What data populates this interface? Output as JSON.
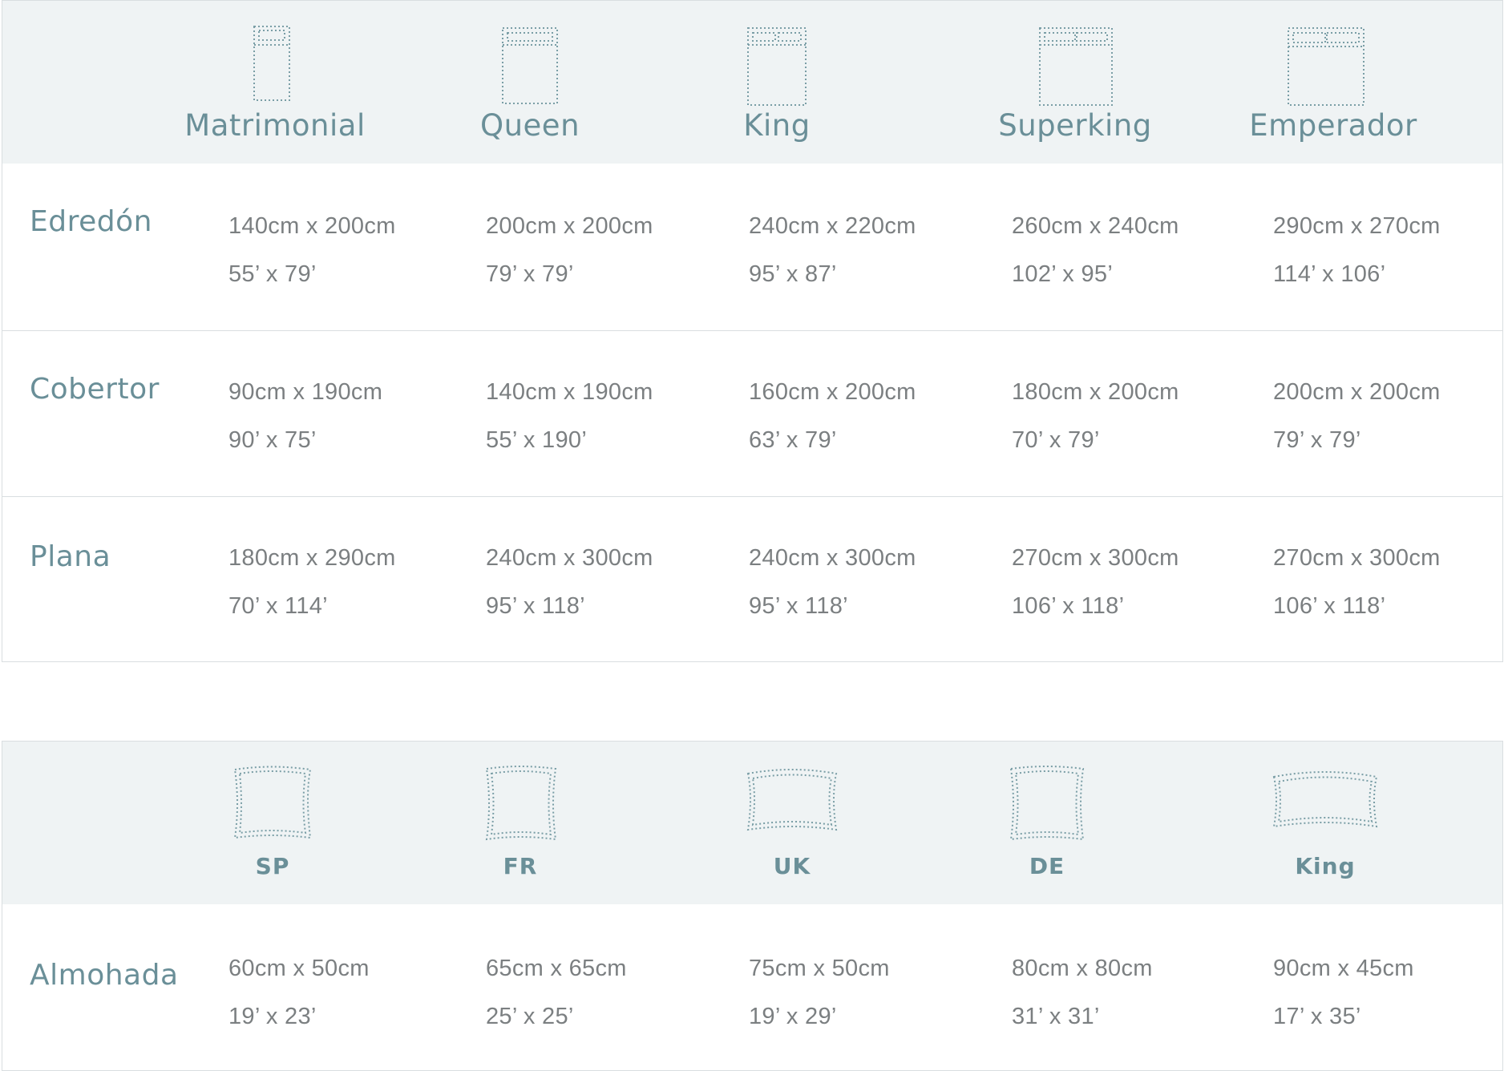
{
  "beds_table": {
    "columns": [
      {
        "label": "Matrimonial",
        "icon": "single-bed-icon"
      },
      {
        "label": "Queen",
        "icon": "queen-bed-icon"
      },
      {
        "label": "King",
        "icon": "king-bed-icon"
      },
      {
        "label": "Superking",
        "icon": "superking-bed-icon"
      },
      {
        "label": "Emperador",
        "icon": "emperador-bed-icon"
      }
    ],
    "rows": [
      {
        "label": "Edredón",
        "cells": [
          {
            "metric": "140cm x 200cm",
            "imperial": "55’ x 79’"
          },
          {
            "metric": "200cm x 200cm",
            "imperial": "79’ x 79’"
          },
          {
            "metric": "240cm x 220cm",
            "imperial": "95’ x 87’"
          },
          {
            "metric": "260cm x 240cm",
            "imperial": "102’ x 95’"
          },
          {
            "metric": "290cm x 270cm",
            "imperial": "114’ x 106’"
          }
        ]
      },
      {
        "label": "Cobertor",
        "cells": [
          {
            "metric": "90cm x 190cm",
            "imperial": "90’ x 75’"
          },
          {
            "metric": "140cm x 190cm",
            "imperial": "55’ x 190’"
          },
          {
            "metric": "160cm x 200cm",
            "imperial": "63’ x 79’"
          },
          {
            "metric": "180cm x 200cm",
            "imperial": "70’ x 79’"
          },
          {
            "metric": "200cm x 200cm",
            "imperial": "79’ x 79’"
          }
        ]
      },
      {
        "label": "Plana",
        "cells": [
          {
            "metric": "180cm x 290cm",
            "imperial": "70’ x 114’"
          },
          {
            "metric": "240cm x 300cm",
            "imperial": "95’ x 118’"
          },
          {
            "metric": "240cm x 300cm",
            "imperial": "95’ x 118’"
          },
          {
            "metric": "270cm x 300cm",
            "imperial": "106’ x 118’"
          },
          {
            "metric": "270cm x 300cm",
            "imperial": "106’ x 118’"
          }
        ]
      }
    ]
  },
  "pillows_table": {
    "columns": [
      {
        "label": "SP",
        "icon": "pillow-icon"
      },
      {
        "label": "FR",
        "icon": "pillow-icon"
      },
      {
        "label": "UK",
        "icon": "pillow-icon"
      },
      {
        "label": "DE",
        "icon": "pillow-icon"
      },
      {
        "label": "King",
        "icon": "pillow-icon"
      }
    ],
    "rows": [
      {
        "label": "Almohada",
        "cells": [
          {
            "metric": "60cm x 50cm",
            "imperial": "19’ x 23’"
          },
          {
            "metric": "65cm x 65cm",
            "imperial": "25’ x 25’"
          },
          {
            "metric": "75cm x 50cm",
            "imperial": "19’ x 29’"
          },
          {
            "metric": "80cm x 80cm",
            "imperial": "31’ x 31’"
          },
          {
            "metric": "90cm x 45cm",
            "imperial": "17’ x 35’"
          }
        ]
      }
    ]
  }
}
